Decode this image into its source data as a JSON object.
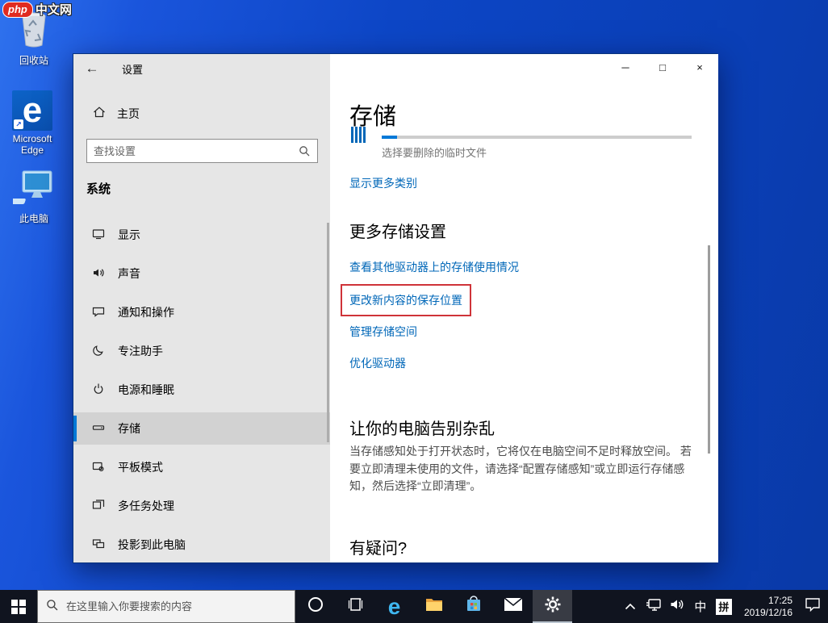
{
  "branding": {
    "logo_main": "php",
    "logo_suffix": "中文网"
  },
  "desktop": {
    "icons": [
      {
        "label": "回收站"
      },
      {
        "label": "Microsoft Edge"
      },
      {
        "label": "此电脑"
      }
    ],
    "edge_glyph": "e",
    "shortcut_glyph": "↗"
  },
  "window": {
    "title": "设置",
    "back_glyph": "←",
    "controls": {
      "minimize": "─",
      "maximize": "□",
      "close": "×"
    },
    "sidebar": {
      "home_label": "主页",
      "search_placeholder": "查找设置",
      "section_label": "系统",
      "items": [
        {
          "label": "显示",
          "selected": false
        },
        {
          "label": "声音",
          "selected": false
        },
        {
          "label": "通知和操作",
          "selected": false
        },
        {
          "label": "专注助手",
          "selected": false
        },
        {
          "label": "电源和睡眠",
          "selected": false
        },
        {
          "label": "存储",
          "selected": true
        },
        {
          "label": "平板模式",
          "selected": false
        },
        {
          "label": "多任务处理",
          "selected": false
        },
        {
          "label": "投影到此电脑",
          "selected": false
        }
      ]
    },
    "content": {
      "page_title": "存储",
      "gauge_caption": "选择要删除的临时文件",
      "gauge_percent": 5,
      "show_more_link": "显示更多类别",
      "more_settings_heading": "更多存储设置",
      "links": [
        {
          "label": "查看其他驱动器上的存储使用情况",
          "highlighted": false
        },
        {
          "label": "更改新内容的保存位置",
          "highlighted": true
        },
        {
          "label": "管理存储空间",
          "highlighted": false
        },
        {
          "label": "优化驱动器",
          "highlighted": false
        }
      ],
      "declutter_heading": "让你的电脑告别杂乱",
      "declutter_body": "当存储感知处于打开状态时，它将仅在电脑空间不足时释放空间。 若要立即清理未使用的文件，请选择“配置存储感知”或立即运行存储感知，然后选择“立即清理”。",
      "question_heading": "有疑问?"
    }
  },
  "taskbar": {
    "search_placeholder": "在这里输入你要搜索的内容",
    "edge_glyph": "e",
    "tray": {
      "ime_lang": "中",
      "ime_mode": "拼",
      "time": "17:25",
      "date": "2019/12/16"
    }
  },
  "colors": {
    "accent": "#0078d7",
    "link": "#0067b8",
    "highlight_box": "#cf3339",
    "taskbar_bg": "#10141f"
  }
}
